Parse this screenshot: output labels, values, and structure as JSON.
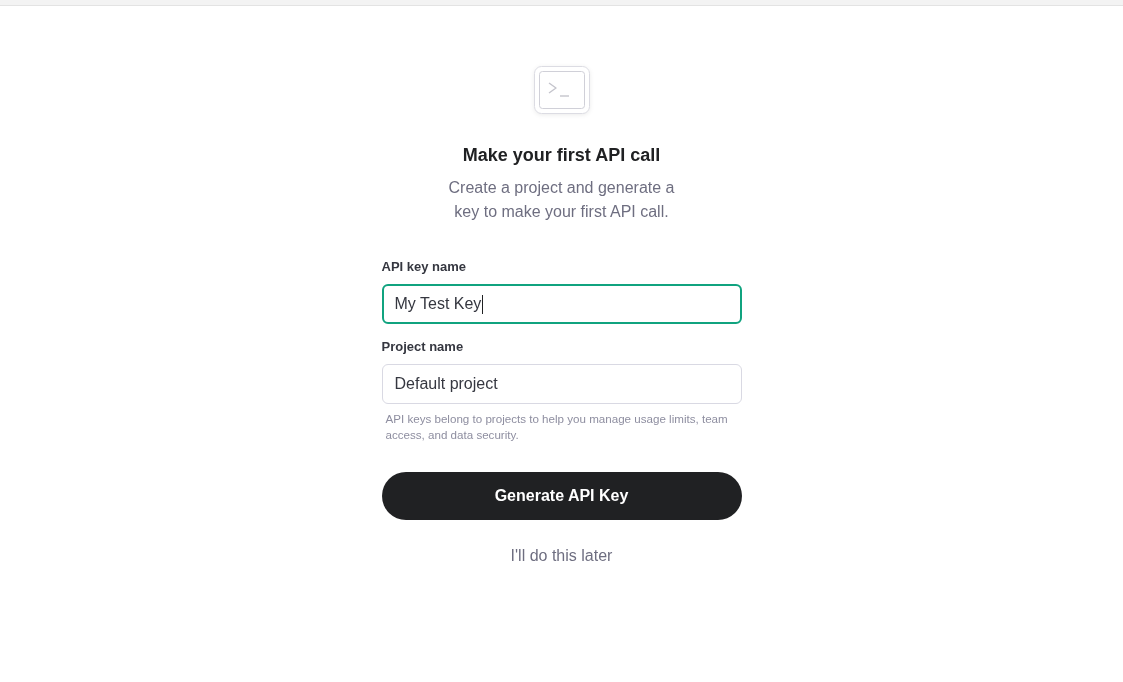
{
  "header": {
    "title": "Make your first API call",
    "subtitle": "Create a project and generate a key to make your first API call."
  },
  "form": {
    "fields": [
      {
        "label": "API key name",
        "value": "My Test Key",
        "focused": true
      },
      {
        "label": "Project name",
        "value": "Default project",
        "focused": false,
        "help": "API keys belong to projects to help you manage usage limits, team access, and data security."
      }
    ]
  },
  "primary_button": "Generate API Key",
  "secondary_link": "I'll do this later"
}
